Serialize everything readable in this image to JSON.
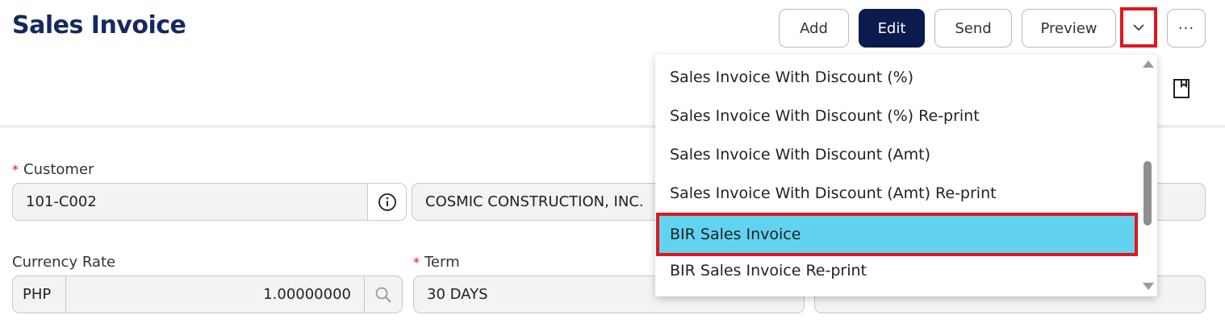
{
  "header": {
    "title": "Sales Invoice",
    "buttons": {
      "add": "Add",
      "edit": "Edit",
      "send": "Send",
      "preview": "Preview",
      "more": "···"
    }
  },
  "form": {
    "customer": {
      "label": "Customer",
      "code": "101-C002",
      "name": "COSMIC CONSTRUCTION, INC."
    },
    "currency": {
      "label": "Currency Rate",
      "code": "PHP",
      "rate": "1.00000000"
    },
    "term": {
      "label": "Term",
      "value": "30 DAYS"
    }
  },
  "preview_dropdown": {
    "items": [
      "Sales Invoice With Discount (%)",
      "Sales Invoice With Discount (%) Re-print",
      "Sales Invoice With Discount (Amt)",
      "Sales Invoice With Discount (Amt) Re-print",
      "BIR Sales Invoice",
      "BIR Sales Invoice Re-print"
    ],
    "selected": "BIR Sales Invoice"
  },
  "colors": {
    "title": "#14295f",
    "primary_button": "#0b1b4d",
    "highlight": "#62d2f1",
    "annotation_box": "#e0161d"
  },
  "icons": [
    "chevron-down-icon",
    "more-icon",
    "bookmark-icon",
    "info-icon",
    "search-icon",
    "scroll-up-icon",
    "scroll-down-icon"
  ]
}
